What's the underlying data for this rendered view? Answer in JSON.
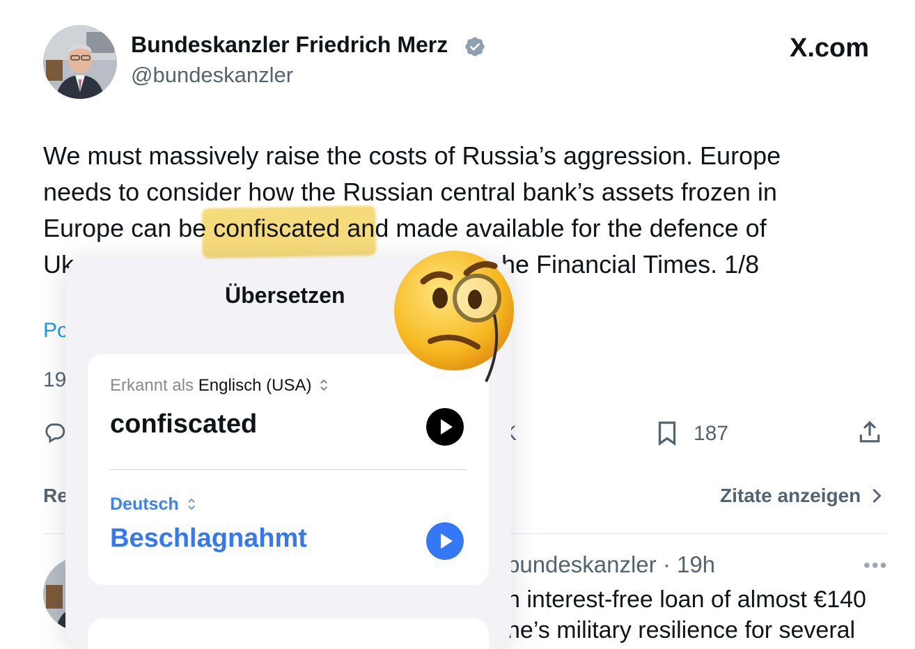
{
  "tweet": {
    "author_name": "Bundeskanzler Friedrich Merz",
    "handle": "@bundeskanzler",
    "site_label": "X.com",
    "body_lines": [
      "We must massively raise the costs of Russia’s aggression. Europe",
      "needs to consider how the Russian central bank’s assets frozen in",
      "Europe can be confiscated and made available for the defence of",
      "Uk…the Financial Times. 1/8"
    ],
    "body_line4_right": "he Financial Times. 1/8",
    "body_line4_left": "Uk",
    "post_link_fragment": "Po",
    "meta_fragment": "19",
    "highlighted_word": "confiscated"
  },
  "actions": {
    "likes_fragment": "K",
    "bookmarks_count": "187"
  },
  "sections": {
    "reposts_fragment": "Re",
    "quotes_link": "Zitate anzeigen"
  },
  "reply": {
    "meta": "bundeskanzler · 19h",
    "line1": "n interest-free loan of almost €140",
    "line2": "ne’s military resilience for several",
    "more_label": "•••"
  },
  "translate": {
    "title": "Übersetzen",
    "detected_label": "Erkannt als",
    "source_language": "Englisch (USA)",
    "source_word": "confiscated",
    "target_language": "Deutsch",
    "target_word": "Beschlagnahmt"
  },
  "colors": {
    "accent_blue": "#3478f6",
    "link_blue": "#1d9bf0",
    "highlight": "#f4d564",
    "muted": "#536471"
  },
  "icons": [
    "verified-badge-icon",
    "reply-icon",
    "bookmark-icon",
    "share-icon",
    "play-icon",
    "chevron-updown-icon",
    "chevron-right-icon",
    "monocle-face-emoji"
  ]
}
